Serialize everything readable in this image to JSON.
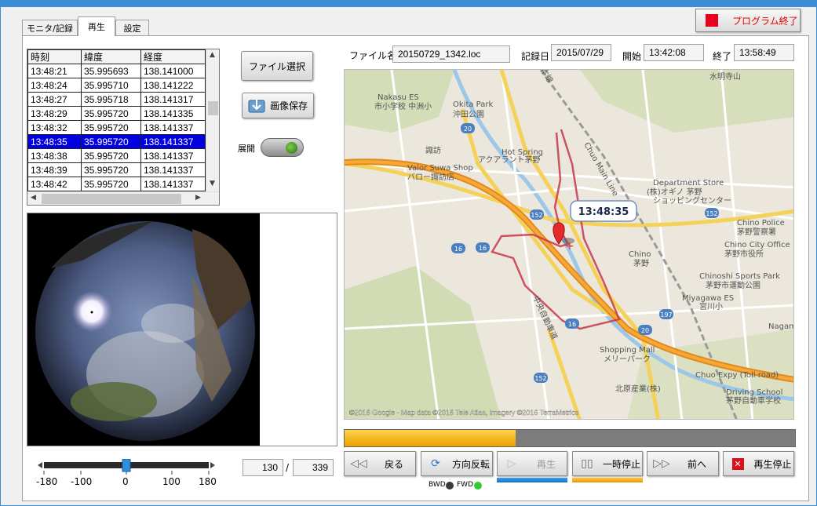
{
  "window": {
    "exit_label": "プログラム終了"
  },
  "tabs": [
    {
      "label": "モニタ/記録"
    },
    {
      "label": "再生"
    },
    {
      "label": "設定"
    }
  ],
  "table": {
    "headers": [
      "時刻",
      "緯度",
      "経度"
    ],
    "rows": [
      [
        "13:48:21",
        "35.995693",
        "138.141000"
      ],
      [
        "13:48:24",
        "35.995710",
        "138.141222"
      ],
      [
        "13:48:27",
        "35.995718",
        "138.141317"
      ],
      [
        "13:48:29",
        "35.995720",
        "138.141335"
      ],
      [
        "13:48:32",
        "35.995720",
        "138.141337"
      ],
      [
        "13:48:35",
        "35.995720",
        "138.141337"
      ],
      [
        "13:48:38",
        "35.995720",
        "138.141337"
      ],
      [
        "13:48:39",
        "35.995720",
        "138.141337"
      ],
      [
        "13:48:42",
        "35.995720",
        "138.141337"
      ]
    ],
    "selected_row": 5
  },
  "buttons": {
    "file_select": "ファイル選択",
    "save_image": "画像保存",
    "expand": "展開"
  },
  "file": {
    "name_label": "ファイル名",
    "name": "20150729_1342.loc",
    "date_label": "記録日",
    "date": "2015/07/29",
    "start_label": "開始",
    "start": "13:42:08",
    "end_label": "終了",
    "end": "13:58:49"
  },
  "map": {
    "time_bubble": "13:48:35",
    "copyright": "©2016 Google - Map data ©2016 Tele Atlas, Imagery ©2016 TerraMetrics",
    "places": [
      "Nakasu ES",
      "市小学校 中洲小",
      "Okita Park",
      "沖田公園",
      "Hot Spring",
      "アクアラント茅野",
      "Valor Suwa Shop",
      "バロー諏訪店",
      "Department Store",
      "(株)オギノ 茅野",
      "ショッピングセンター",
      "Chino Police",
      "茅野警察署",
      "Chino City Office",
      "茅野市役所",
      "Chino",
      "茅野",
      "Chinoshi Sports Park",
      "茅野市運動公園",
      "Miyagawa ES",
      "宮川小",
      "Nagami",
      "Shopping Mall",
      "メリーパーク",
      "Chuo Expy (Toll road)",
      "北原産業(株)",
      "Driving School",
      "茅野自動車学校",
      "Chuo Main Line",
      "中央自動車道",
      "水明寺山",
      "諏訪",
      "本線"
    ],
    "route_shields": [
      "20",
      "152",
      "16",
      "16",
      "197",
      "20",
      "152",
      "16",
      "152"
    ]
  },
  "playback": {
    "progress": 0.38,
    "current_frame": "130",
    "total_frames": "339",
    "slider_ticks": [
      "-180",
      "-100",
      "0",
      "100",
      "180"
    ],
    "slider_value": 0,
    "back": "戻る",
    "reverse": "方向反転",
    "play": "再生",
    "pause": "一時停止",
    "forward": "前へ",
    "stop": "再生停止",
    "bwd": "BWD",
    "fwd": "FWD"
  },
  "colors": {
    "selection": "#0000e0",
    "accent_orange": "#f0a800",
    "stop_red": "#e8001c",
    "fwd_green": "#33cc33"
  }
}
